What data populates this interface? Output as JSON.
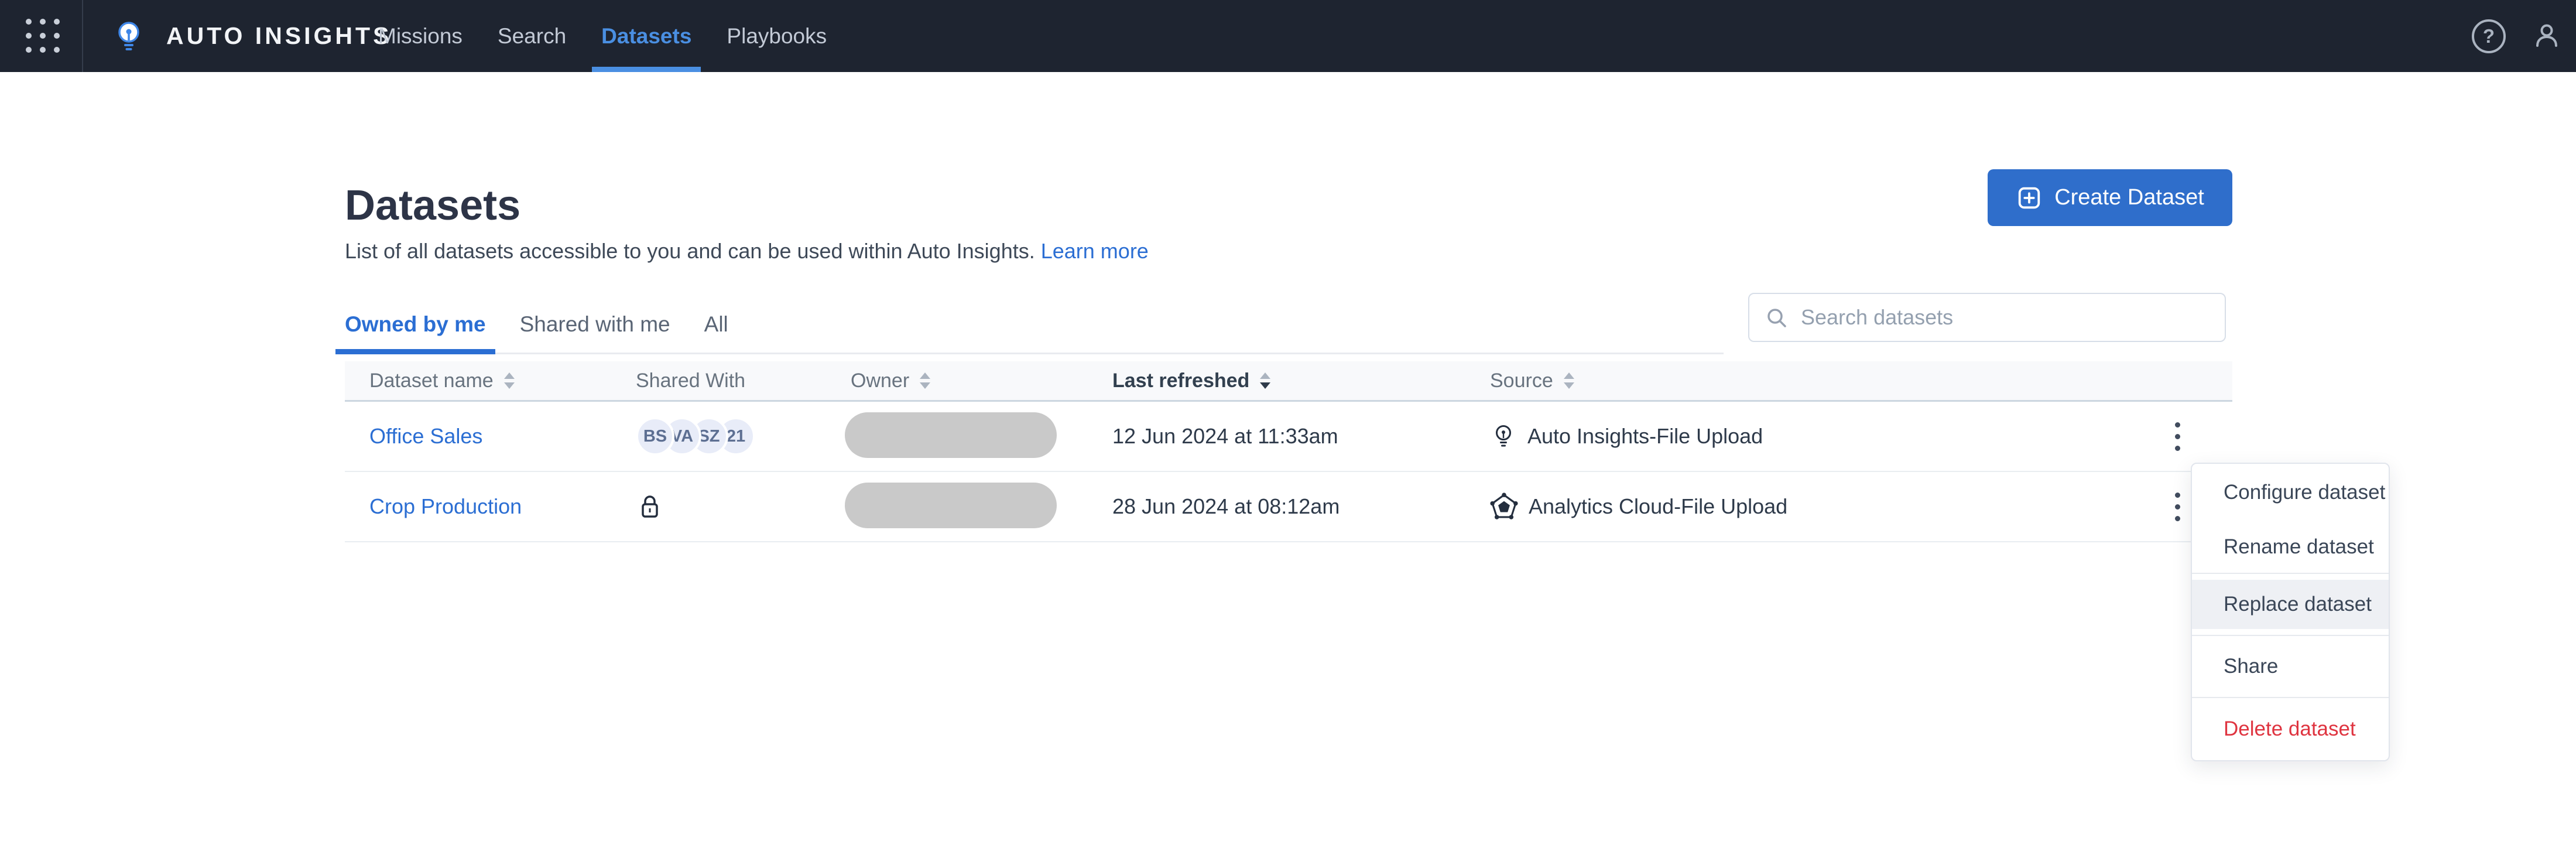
{
  "topbar": {
    "brand": "AUTO INSIGHTS",
    "nav": [
      {
        "label": "Missions",
        "active": false
      },
      {
        "label": "Search",
        "active": false
      },
      {
        "label": "Datasets",
        "active": true
      },
      {
        "label": "Playbooks",
        "active": false
      }
    ],
    "icons": {
      "app_launcher": "grid-9-dots",
      "brand_logo": "lightbulb",
      "help": "question-mark-circle",
      "account": "person-outline"
    },
    "colors": {
      "background": "#1e2430",
      "active_link": "#4a8fe2",
      "inactive_link": "#c3cad6"
    }
  },
  "page": {
    "title": "Datasets",
    "description": "List of all datasets accessible to you and can be used within Auto Insights.",
    "learn_more_label": "Learn more",
    "create_button_label": "Create Dataset",
    "accent_color": "#2f6ecb"
  },
  "tabs": [
    {
      "label": "Owned by me",
      "active": true
    },
    {
      "label": "Shared with me",
      "active": false
    },
    {
      "label": "All",
      "active": false
    }
  ],
  "search": {
    "placeholder": "Search datasets"
  },
  "table": {
    "columns": [
      {
        "label": "Dataset name",
        "sortable": true
      },
      {
        "label": "Shared With",
        "sortable": false
      },
      {
        "label": "Owner",
        "sortable": true
      },
      {
        "label": "Last refreshed",
        "sortable": true,
        "sorted": "desc"
      },
      {
        "label": "Source",
        "sortable": true
      },
      {
        "label": "",
        "sortable": false
      }
    ],
    "rows": [
      {
        "name": "Office Sales",
        "shared_type": "avatars",
        "shared": [
          "BS",
          "VA",
          "SZ",
          "21"
        ],
        "owner": "redacted",
        "last_refreshed": "12 Jun 2024 at 11:33am",
        "source": "Auto Insights-File Upload",
        "source_icon": "lightbulb-icon"
      },
      {
        "name": "Crop Production",
        "shared_type": "private-lock",
        "shared": [],
        "owner": "redacted",
        "last_refreshed": "28 Jun 2024 at 08:12am",
        "source": "Analytics Cloud-File Upload",
        "source_icon": "analytics-cloud-pentagon-icon"
      }
    ]
  },
  "context_menu": {
    "items": [
      {
        "label": "Configure dataset",
        "state": "normal"
      },
      {
        "label": "Rename dataset",
        "state": "normal"
      },
      {
        "label": "Replace dataset",
        "state": "highlighted"
      },
      {
        "label": "Share",
        "state": "normal"
      },
      {
        "label": "Delete dataset",
        "state": "danger"
      }
    ],
    "danger_color": "#df3440",
    "highlight_color": "#eef0f4"
  },
  "misc": {
    "help_glyph": "?"
  }
}
